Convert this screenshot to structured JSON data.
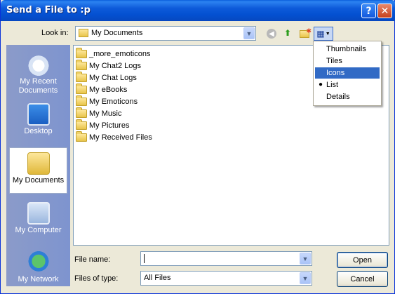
{
  "window": {
    "title": "Send a File to :p",
    "help_label": "?",
    "close_label": "✕"
  },
  "toolbar": {
    "look_in_label": "Look in:",
    "look_in_value": "My Documents",
    "views_menu": [
      "Thumbnails",
      "Tiles",
      "Icons",
      "List",
      "Details"
    ],
    "views_selected": "List",
    "views_highlighted": "Icons"
  },
  "places": [
    {
      "label": "My Recent Documents",
      "icon": "recent-documents-icon"
    },
    {
      "label": "Desktop",
      "icon": "desktop-icon"
    },
    {
      "label": "My Documents",
      "icon": "my-documents-icon",
      "selected": true
    },
    {
      "label": "My Computer",
      "icon": "my-computer-icon"
    },
    {
      "label": "My Network",
      "icon": "my-network-icon"
    }
  ],
  "files": [
    "_more_emoticons",
    "My Chat2 Logs",
    "My Chat Logs",
    "My eBooks",
    "My Emoticons",
    "My Music",
    "My Pictures",
    "My Received Files"
  ],
  "form": {
    "file_name_label": "File name:",
    "file_name_value": "",
    "files_of_type_label": "Files of type:",
    "files_of_type_value": "All Files",
    "open_label": "Open",
    "cancel_label": "Cancel"
  },
  "colors": {
    "titlebar": "#0450d1",
    "window_bg": "#ece9d8",
    "places_bg": "#7e94cf",
    "menu_highlight": "#316ac5"
  }
}
